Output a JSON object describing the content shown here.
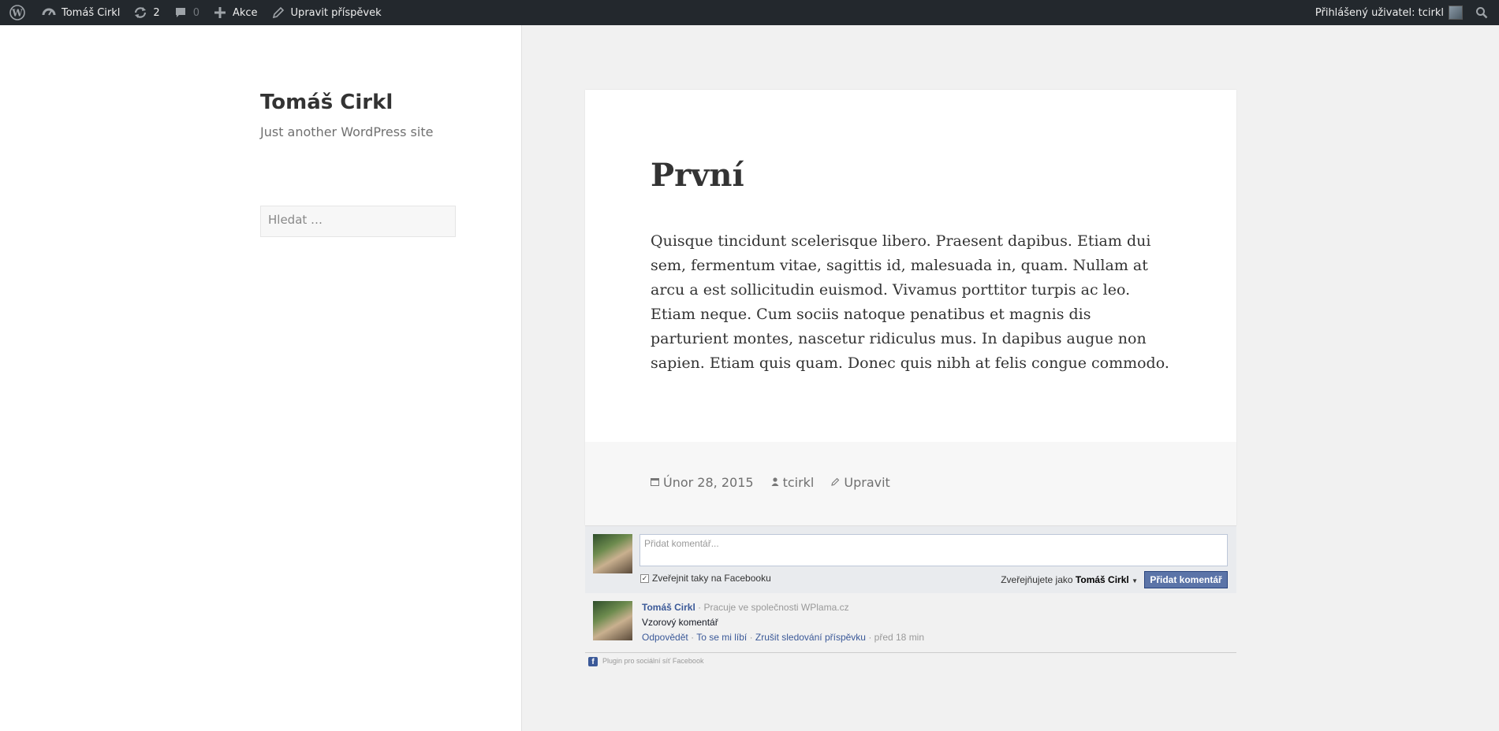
{
  "admin_bar": {
    "site_name": "Tomáš Cirkl",
    "updates_count": "2",
    "comments_count": "0",
    "new_label": "Akce",
    "edit_post_label": "Upravit příspěvek",
    "logged_in_label": "Přihlášený uživatel: tcirkl"
  },
  "sidebar": {
    "site_title": "Tomáš Cirkl",
    "site_description": "Just another WordPress site",
    "search_placeholder": "Hledat …"
  },
  "post": {
    "title": "První",
    "body": "Quisque tincidunt scelerisque libero. Praesent dapibus. Etiam dui sem, fermentum vitae, sagittis id, malesuada in, quam. Nullam at arcu a est sollicitudin euismod. Vivamus porttitor turpis ac leo. Etiam neque. Cum sociis natoque penatibus et magnis dis parturient montes, nascetur ridiculus mus. In dapibus augue non sapien. Etiam quis quam. Donec quis nibh at felis congue commodo.",
    "meta": {
      "date": "Únor 28, 2015",
      "author": "tcirkl",
      "edit": "Upravit"
    }
  },
  "facebook": {
    "input_placeholder": "Přidat komentář...",
    "share_checkbox_label": "Zveřejnit taky na Facebooku",
    "posting_as_prefix": "Zveřejňujete jako",
    "posting_as_name": "Tomáš Cirkl",
    "post_button": "Přidat komentář",
    "comment": {
      "author": "Tomáš Cirkl",
      "work": "Pracuje ve společnosti",
      "company": "WPlama.cz",
      "text": "Vzorový komentář",
      "reply": "Odpovědět",
      "like": "To se mi líbí",
      "unfollow": "Zrušit sledování příspěvku",
      "time": "před 18 min"
    },
    "plugin_label": "Plugin pro sociální síť Facebook"
  }
}
